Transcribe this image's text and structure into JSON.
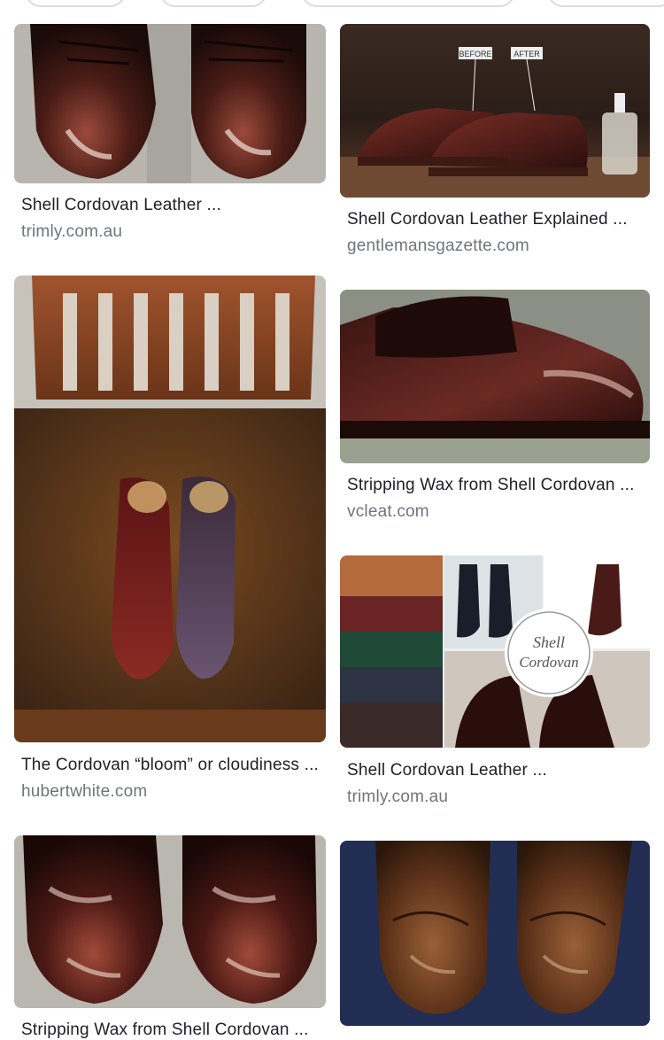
{
  "filter_chips": [
    "",
    "",
    "",
    ""
  ],
  "results": [
    {
      "title": "Shell Cordovan Leather ...",
      "source": "trimly.com.au",
      "image": "two-cordovan-shoes-toes"
    },
    {
      "title": "Shell Cordovan Leather Explained ...",
      "source": "gentlemansgazette.com",
      "image": "before-after-shoes-on-table",
      "image_labels": [
        "BEFORE",
        "AFTER"
      ]
    },
    {
      "title": "Stripping Wax from Shell Cordovan ...",
      "source": "vcleat.com",
      "image": "dark-burgundy-derby-shoes"
    },
    {
      "title": "The Cordovan “bloom” or cloudiness ...",
      "source": "hubertwhite.com",
      "image": "shoes-on-wooden-chair"
    },
    {
      "title": "Shell Cordovan Leather ...",
      "source": "trimly.com.au",
      "image": "cordovan-collage",
      "image_labels": [
        "Shell",
        "Cordovan"
      ]
    },
    {
      "title": "Stripping Wax from Shell Cordovan ...",
      "source": "",
      "image": "shoe-toes-close-up"
    },
    {
      "title": "",
      "source": "",
      "image": "brown-loafers-on-blue"
    }
  ]
}
